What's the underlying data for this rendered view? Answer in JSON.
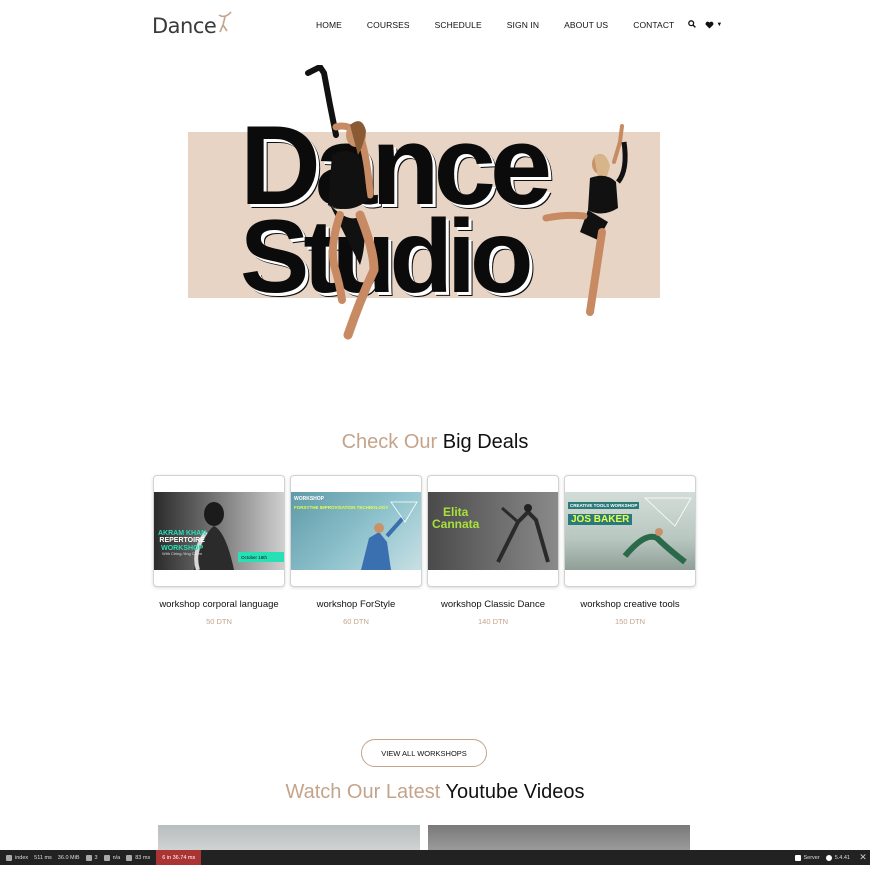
{
  "header": {
    "logo_text": "Dance",
    "nav": [
      "HOME",
      "COURSES",
      "SCHEDULE",
      "SIGN IN",
      "ABOUT US",
      "CONTACT"
    ],
    "icons": [
      "search-icon",
      "heart-icon",
      "caret-down-icon"
    ]
  },
  "hero": {
    "word1": "Dance",
    "word2": "Studio"
  },
  "deals": {
    "title_accent": "Check Our",
    "title_dark": "Big Deals",
    "items": [
      {
        "name": "workshop corporal language",
        "price": "50 DTN",
        "img_lines": [
          "AKRAM KHAN",
          "REPERTOIRE",
          "WORKSHOP",
          "With Ching-Ying Chien"
        ],
        "img_badge": "October 16th"
      },
      {
        "name": "workshop ForStyle",
        "price": "60 DTN",
        "img_lines": [
          "WORKSHOP",
          "FORSYTHE IMPROVISATION TECHNOLOGY"
        ]
      },
      {
        "name": "workshop Classic Dance",
        "price": "140 DTN",
        "img_lines": [
          "Elita",
          "Cannata"
        ]
      },
      {
        "name": "workshop creative tools",
        "price": "150 DTN",
        "img_lines": [
          "CREATIVE TOOLS WORKSHOP",
          "JOS BAKER"
        ]
      }
    ],
    "button_label": "VIEW ALL WORKSHOPS"
  },
  "videos": {
    "title_accent": "Watch Our Latest",
    "title_dark": "Youtube Videos"
  },
  "toolbar": {
    "route": "index",
    "time": "511 ms",
    "memory": "36.0 MiB",
    "count1": "3",
    "user": "n/a",
    "ms2": "83 ms",
    "timer": "6 in 36.74 ms",
    "server": "Server",
    "version": "5.4.41"
  },
  "colors": {
    "accent": "#c4a48b",
    "hero_bg": "#e7d4c5",
    "toolbar_bg": "#222222",
    "toolbar_timer": "#a33333"
  }
}
